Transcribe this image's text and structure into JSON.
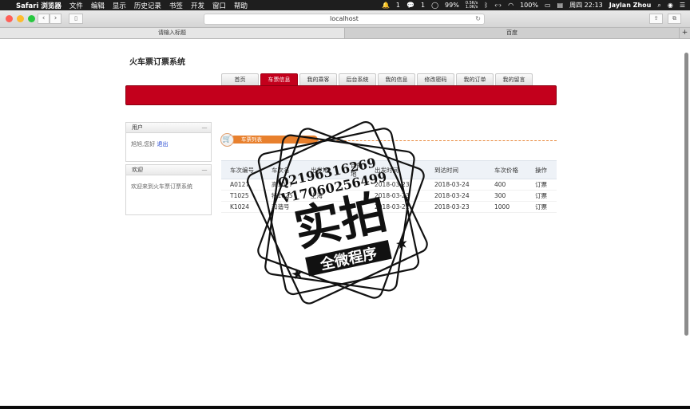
{
  "menubar": {
    "app": "Safari 浏览器",
    "items": [
      "文件",
      "编辑",
      "显示",
      "历史记录",
      "书签",
      "开发",
      "窗口",
      "帮助"
    ],
    "status": {
      "notif_count_1": "1",
      "notif_count_2": "1",
      "cpu": "99%",
      "net_up": "0.5K/s",
      "net_down": "1.0K/s",
      "battery": "100%",
      "datetime": "周四 22:13",
      "user": "Jaylan Zhou"
    }
  },
  "browser": {
    "url": "localhost",
    "tabs": [
      {
        "label": "请输入标题",
        "active": true
      },
      {
        "label": "百度",
        "active": false
      }
    ]
  },
  "site": {
    "title": "火车票订票系统",
    "nav": [
      {
        "label": "首页",
        "active": false
      },
      {
        "label": "车票信息",
        "active": true
      },
      {
        "label": "我的乘客",
        "active": false
      },
      {
        "label": "后台系统",
        "active": false
      },
      {
        "label": "我的信息",
        "active": false
      },
      {
        "label": "修改密码",
        "active": false
      },
      {
        "label": "我的订单",
        "active": false
      },
      {
        "label": "我的留言",
        "active": false
      }
    ],
    "accent_color": "#c3001c",
    "user_panel": {
      "title": "用户",
      "greeting": "旭旭,您好",
      "logout": "退出"
    },
    "welcome_panel": {
      "title": "欢迎",
      "text": "欢迎来到火车票订票系统"
    },
    "list_title": "车票列表",
    "table": {
      "columns": [
        "车次编号",
        "车次名",
        "出发地",
        "目的地",
        "出发时间",
        "到达时间",
        "车次价格",
        "操作"
      ],
      "rows": [
        [
          "A0127",
          "高1027",
          "",
          "",
          "2018-03-23",
          "2018-03-24",
          "400",
          "订票"
        ],
        [
          "T1025",
          "特1025",
          "上海",
          "",
          "2018-03-23",
          "2018-03-24",
          "300",
          "订票"
        ],
        [
          "K1024",
          "和谐号",
          "",
          "",
          "2018-03-22",
          "2018-03-23",
          "1000",
          "订票"
        ]
      ]
    }
  },
  "watermark": {
    "qq": "Q2196316269",
    "vx": "V17060256499",
    "main": "实拍",
    "sub": "全微程序"
  }
}
